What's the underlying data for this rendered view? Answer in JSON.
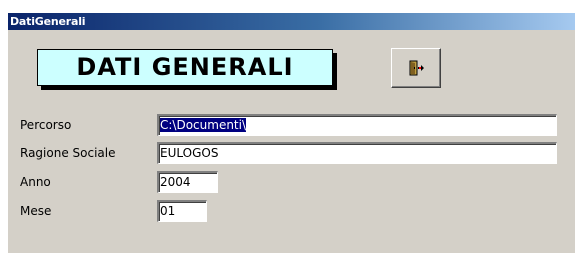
{
  "window": {
    "title": "DatiGenerali"
  },
  "header": {
    "title": "DATI GENERALI"
  },
  "toolbar": {
    "exit_icon": "exit-door-icon"
  },
  "fields": {
    "percorso": {
      "label": "Percorso",
      "value": "C:\\Documenti\\"
    },
    "ragione_sociale": {
      "label": "Ragione Sociale",
      "value": "EULOGOS"
    },
    "anno": {
      "label": "Anno",
      "value": "2004"
    },
    "mese": {
      "label": "Mese",
      "value": "01"
    }
  },
  "colors": {
    "title_bar_start": "#0a246a",
    "title_bar_end": "#a6caf0",
    "header_background": "#ccffff",
    "form_background": "#d4d0c8",
    "selection": "#000080"
  }
}
